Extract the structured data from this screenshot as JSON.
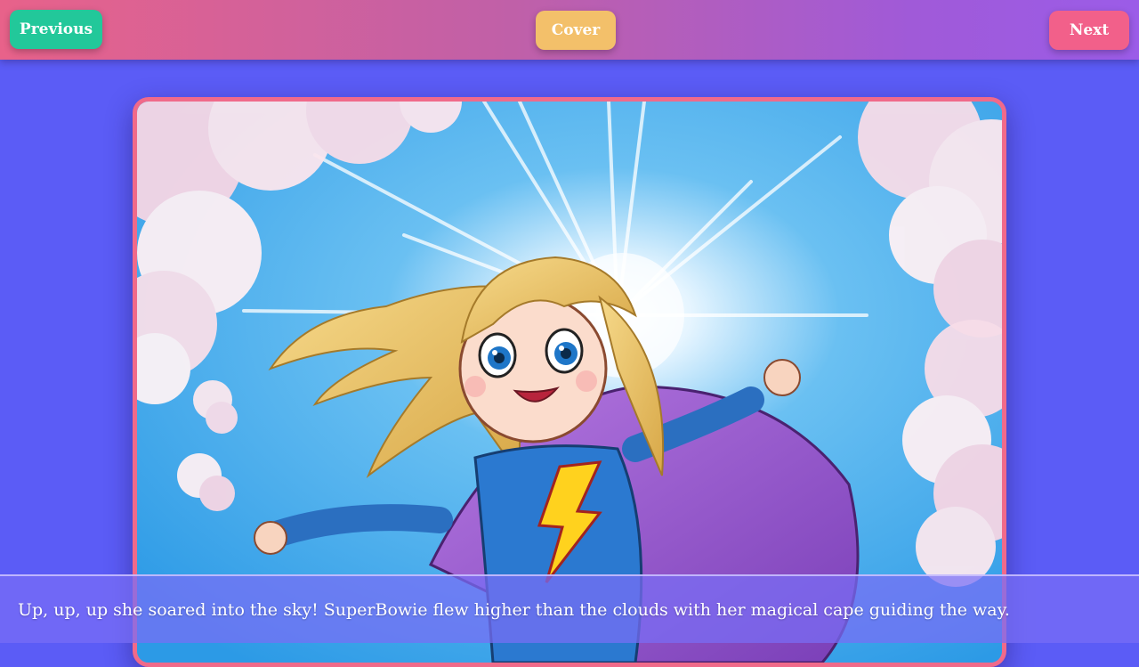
{
  "nav": {
    "previous_label": "Previous",
    "cover_label": "Cover",
    "next_label": "Next"
  },
  "page": {
    "caption": "Up, up, up she soared into the sky! SuperBowie flew higher than the clouds with her magical cape guiding the way."
  },
  "illustration": {
    "subject": "cartoon superhero girl flying in the sky",
    "icon": "lightning-bolt-icon"
  },
  "colors": {
    "background": "#5b5cf6",
    "previous_button": "#22c89a",
    "cover_button": "#f3c06a",
    "next_button": "#f2608a",
    "frame_border": "#f06a8a"
  }
}
